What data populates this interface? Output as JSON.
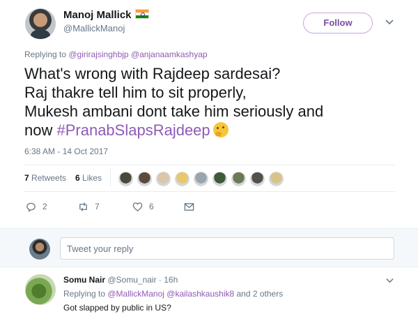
{
  "tweet": {
    "author_name": "Manoj Mallick",
    "author_handle": "@MallickManoj",
    "follow_label": "Follow",
    "replying_prefix": "Replying to ",
    "replying_to": [
      "@girirajsinghbjp",
      "@anjanaamkashyap"
    ],
    "text_lines": [
      "What's wrong with Rajdeep sardesai?",
      "Raj thakre tell him to sit properly,",
      "Mukesh ambani dont take him seriously and",
      "now "
    ],
    "hashtag": "#PranabSlapsRajdeep",
    "timestamp": "6:38 AM - 14 Oct 2017",
    "retweets_count": "7",
    "retweets_label": "Retweets",
    "likes_count": "6",
    "likes_label": "Likes",
    "actions": {
      "reply_count": "2",
      "retweet_count": "7",
      "like_count": "6"
    },
    "liker_colors": [
      "#4a4a3a",
      "#5c4a3c",
      "#d9c7a8",
      "#e8c86a",
      "#9aa4ad",
      "#3e5a36",
      "#6b7a54",
      "#54504a",
      "#d8c48a"
    ]
  },
  "reply_box": {
    "placeholder": "Tweet your reply"
  },
  "reply": {
    "author_name": "Somu Nair",
    "author_handle": "@Somu_nair",
    "separator": " · ",
    "time": "16h",
    "replying_prefix": "Replying to ",
    "replying_to": [
      "@MallickManoj",
      "@kailashkaushik8"
    ],
    "and_others": " and 2 others",
    "text": "Got slapped by public in US?"
  },
  "colors": {
    "accent": "#8e5bb5",
    "secondary_text": "#657786",
    "primary_text": "#14171a"
  }
}
